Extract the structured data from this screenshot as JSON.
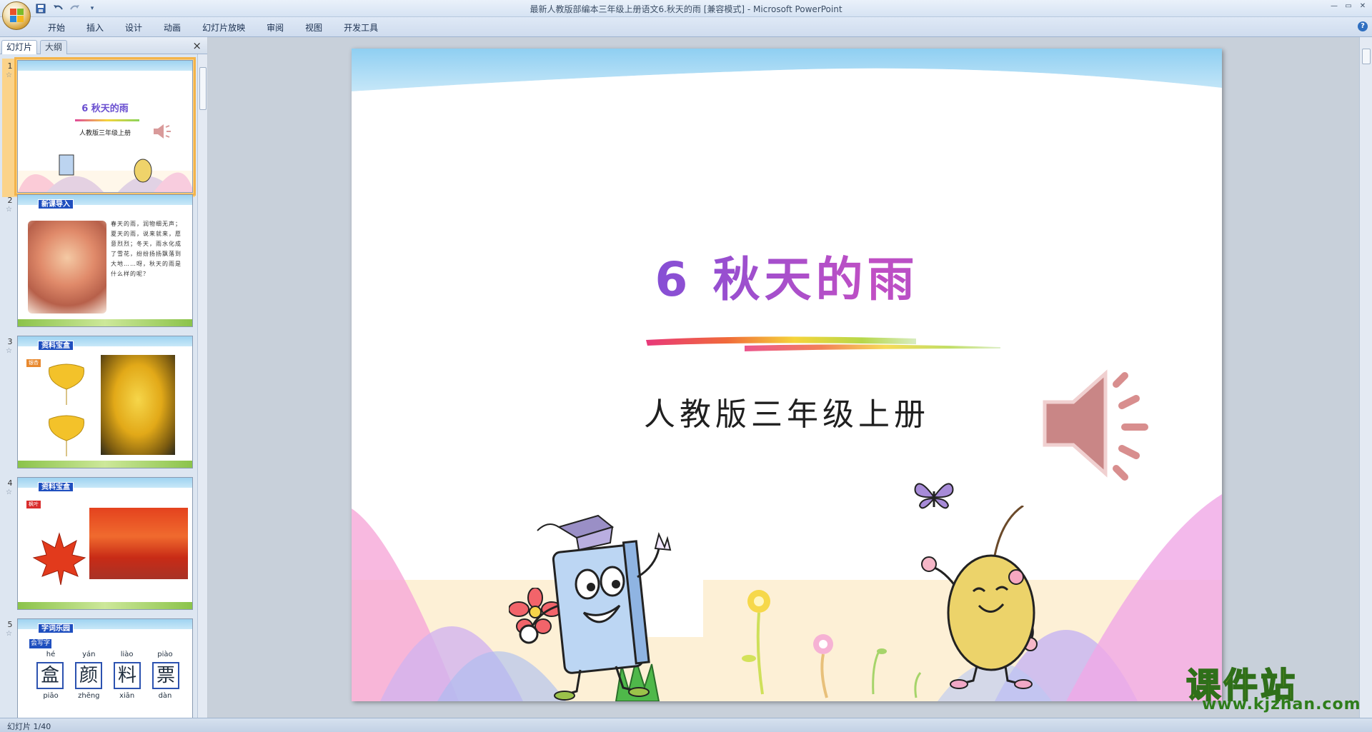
{
  "window": {
    "title": "最新人教版部编本三年级上册语文6.秋天的雨 [兼容模式] - Microsoft PowerPoint"
  },
  "ribbon": {
    "tabs": [
      "开始",
      "插入",
      "设计",
      "动画",
      "幻灯片放映",
      "审阅",
      "视图",
      "开发工具"
    ]
  },
  "pane": {
    "tab_slides": "幻灯片",
    "tab_outline": "大纲",
    "close": "×"
  },
  "thumbnails": [
    {
      "num": "1",
      "title": "6 秋天的雨",
      "subtitle": "人教版三年级上册"
    },
    {
      "num": "2",
      "tag": "新课导入",
      "text": "春天的雨，润物细无声；夏天的雨，说来就来，愿意烈烈；冬天，雨水化成了雪花，纷纷扬扬飘落到大地……呀，秋天的雨是什么样的呢？"
    },
    {
      "num": "3",
      "tag": "资料宝盒",
      "label": "银杏"
    },
    {
      "num": "4",
      "tag": "资料宝盒",
      "label": "枫叶"
    },
    {
      "num": "5",
      "tag": "字词乐园",
      "label": "会写字",
      "pinyin": [
        "hé",
        "yán",
        "liào",
        "piào"
      ],
      "chars": [
        "盒",
        "颜",
        "料",
        "票"
      ],
      "pinyin2": [
        "piāo",
        "zhēng",
        "xiān",
        "dàn"
      ]
    }
  ],
  "slide": {
    "title": "6 秋天的雨",
    "subtitle": "人教版三年级上册"
  },
  "status": {
    "slide_info": "幻灯片 1/40"
  },
  "watermark": {
    "cn": "课件站",
    "url": "www.kjzhan.com"
  },
  "colors": {
    "title_gradient_start": "#3f5ad9",
    "title_gradient_end": "#c04fc4",
    "sky_blue": "#8fcff2",
    "selection": "#f4b44a"
  },
  "icons": {
    "save": "save-icon",
    "undo": "undo-icon",
    "redo": "redo-icon",
    "speaker": "speaker-icon"
  }
}
